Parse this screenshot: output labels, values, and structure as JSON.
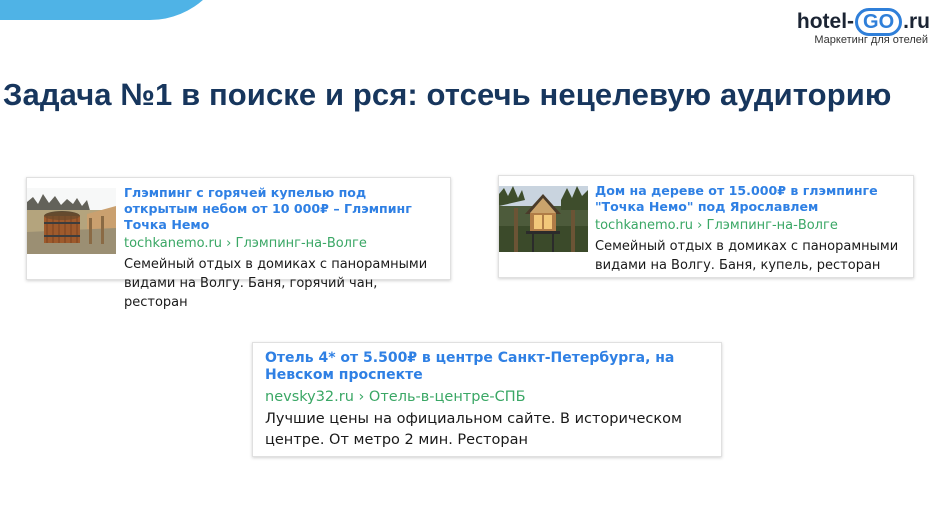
{
  "logo": {
    "prefix": "hotel-",
    "badge": "GO",
    "suffix": ".ru",
    "tagline": "Маркетинг для отелей"
  },
  "page": {
    "title": "Задача №1 в поиске и рся: отсечь нецелевую аудиторию"
  },
  "ads": [
    {
      "title": "Глэмпинг с горячей купелью под открытым небом от 10 000₽ – Глэмпинг Точка Немо",
      "url": "tochkanemo.ru › Глэмпинг-на-Волге",
      "description": "Семейный отдых в домиках с панорамными видами на Волгу. Баня, горячий чан, ресторан",
      "image": "hot-tub-deck-photo"
    },
    {
      "title": "Дом на дереве от 15.000₽ в глэмпинге \"Точка Немо\" под Ярославлем",
      "url": "tochkanemo.ru › Глэмпинг-на-Волге",
      "description": "Семейный отдых в домиках с панорамными видами на Волгу. Баня, купель, ресторан",
      "image": "treehouse-cabin-photo"
    },
    {
      "title": "Отель 4* от 5.500₽ в центре Санкт-Петербурга, на Невском проспекте",
      "url": "nevsky32.ru › Отель-в-центре-СПБ",
      "description": "Лучшие цены на официальном сайте. В историческом центре. От метро 2 мин. Ресторан"
    }
  ]
}
